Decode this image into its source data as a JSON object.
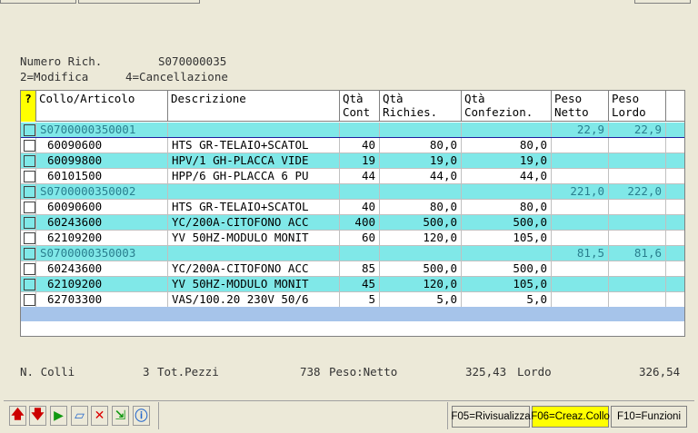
{
  "header": {
    "numero_label": "Numero Rich.",
    "numero_value": "S070000035",
    "mode_modifica": "2=Modifica",
    "mode_cancellazione": "4=Cancellazione"
  },
  "grid": {
    "columns": [
      "?",
      "Collo/Articolo",
      "Descrizione",
      "Qtà\nCont",
      "Qtà\nRichies.",
      "Qtà\nConfezion.",
      "Peso\nNetto",
      "Peso\nLordo"
    ],
    "rows": [
      {
        "type": "group",
        "code": "S0700000350001",
        "netto": "22,9",
        "lordo": "22,9"
      },
      {
        "type": "item",
        "code": "60090600",
        "desc": "HTS GR-TELAIO+SCATOL",
        "cont": "40",
        "rich": "80,0",
        "conf": "80,0"
      },
      {
        "type": "item",
        "code": "60099800",
        "desc": "HPV/1 GH-PLACCA VIDE",
        "cont": "19",
        "rich": "19,0",
        "conf": "19,0"
      },
      {
        "type": "item",
        "code": "60101500",
        "desc": "HPP/6 GH-PLACCA 6 PU",
        "cont": "44",
        "rich": "44,0",
        "conf": "44,0"
      },
      {
        "type": "group",
        "code": "S0700000350002",
        "netto": "221,0",
        "lordo": "222,0"
      },
      {
        "type": "item",
        "code": "60090600",
        "desc": "HTS GR-TELAIO+SCATOL",
        "cont": "40",
        "rich": "80,0",
        "conf": "80,0"
      },
      {
        "type": "item",
        "code": "60243600",
        "desc": "YC/200A-CITOFONO ACC",
        "cont": "400",
        "rich": "500,0",
        "conf": "500,0"
      },
      {
        "type": "item",
        "code": "62109200",
        "desc": "YV 50HZ-MODULO MONIT",
        "cont": "60",
        "rich": "120,0",
        "conf": "105,0"
      },
      {
        "type": "group",
        "code": "S0700000350003",
        "netto": "81,5",
        "lordo": "81,6"
      },
      {
        "type": "item",
        "code": "60243600",
        "desc": "YC/200A-CITOFONO ACC",
        "cont": "85",
        "rich": "500,0",
        "conf": "500,0"
      },
      {
        "type": "item",
        "code": "62109200",
        "desc": "YV 50HZ-MODULO MONIT",
        "cont": "45",
        "rich": "120,0",
        "conf": "105,0"
      },
      {
        "type": "item",
        "code": "62703300",
        "desc": "VAS/100.20 230V 50/6",
        "cont": "5",
        "rich": "5,0",
        "conf": "5,0"
      }
    ]
  },
  "totals": {
    "colli_label": "N. Colli",
    "colli_value": "3",
    "pezzi_label": "Tot.Pezzi",
    "pezzi_value": "738",
    "netto_label": "Peso:Netto",
    "netto_value": "325,43",
    "lordo_label": "Lordo",
    "lordo_value": "326,54"
  },
  "toolbar": {
    "f05": "F05=Rivisualizza",
    "f06": "F06=Creaz.Collo",
    "f10": "F10=Funzioni"
  },
  "colors": {
    "cyan_row": "#80E8E8",
    "yellow_highlight": "#FFFF00",
    "footer_band": "#A6C4EA"
  }
}
